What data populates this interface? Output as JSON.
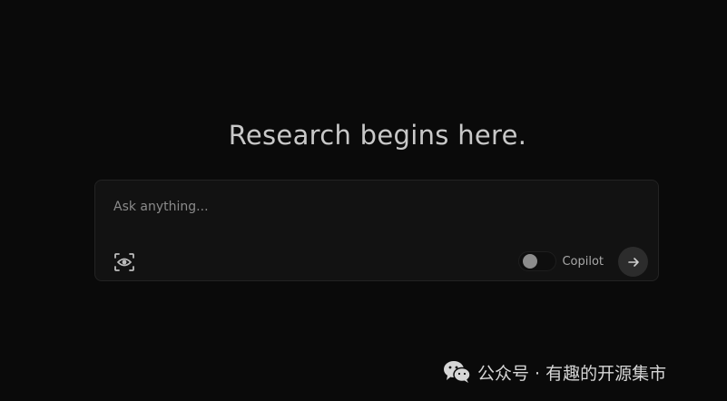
{
  "hero": {
    "title": "Research begins here."
  },
  "search": {
    "placeholder": "Ask anything..."
  },
  "toolbar": {
    "focus_icon": "eye-scan-icon",
    "copilot_label": "Copilot",
    "copilot_enabled": false,
    "submit_icon": "arrow-right-icon"
  },
  "watermark": {
    "icon": "wechat-icon",
    "text": "公众号 · 有趣的开源集市"
  },
  "colors": {
    "background": "#0a0a0a",
    "panel": "#121212",
    "panel_border": "#232323",
    "title_text": "#c8c8c8",
    "placeholder_text": "#8a8a8a",
    "button": "#2c2c2c"
  }
}
